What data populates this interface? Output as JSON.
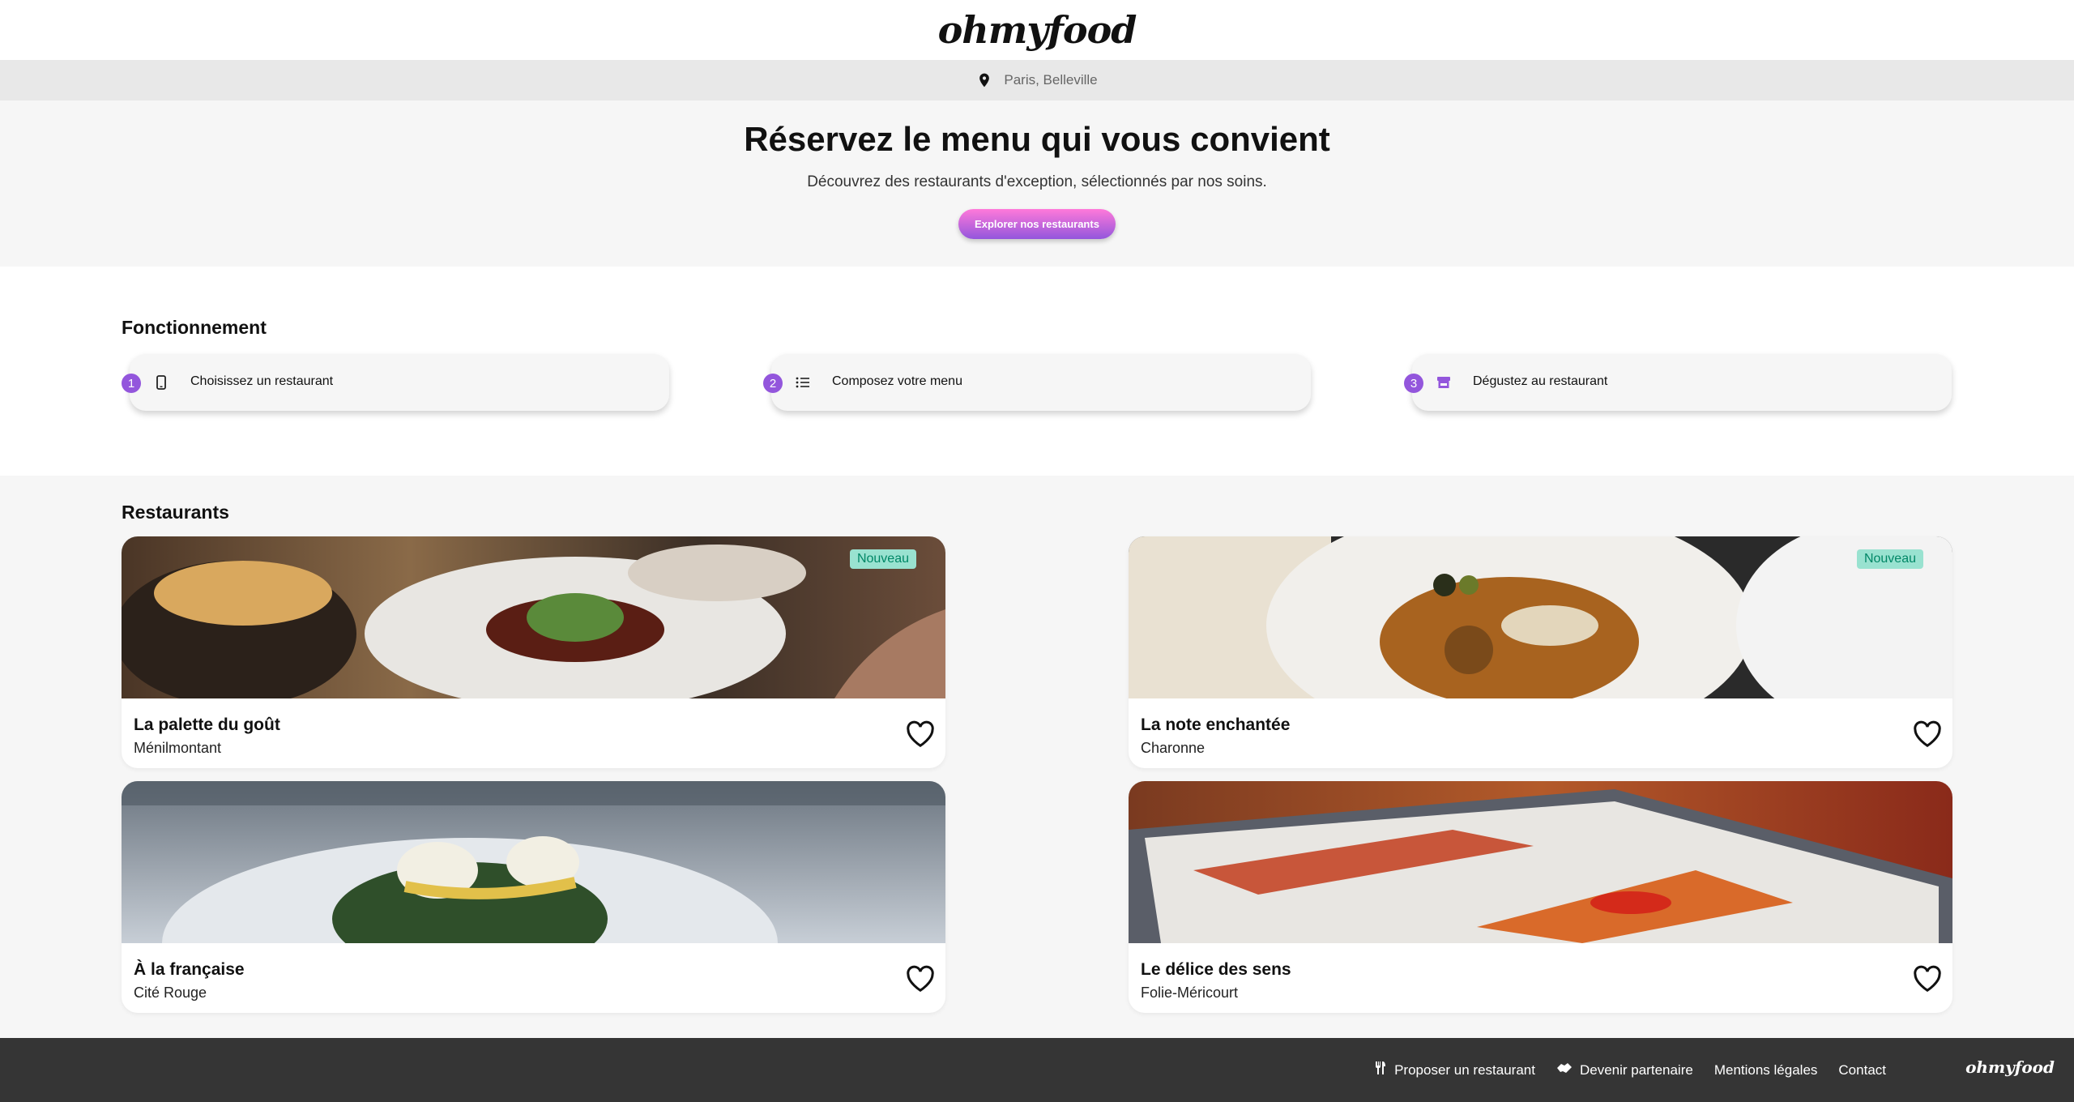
{
  "header": {
    "logo": "ohmyfood"
  },
  "location": {
    "text": "Paris, Belleville",
    "icon": "map-pin-icon"
  },
  "hero": {
    "title": "Réservez le menu qui vous convient",
    "subtitle": "Découvrez des restaurants d'exception, sélectionnés par nos soins.",
    "cta": "Explorer nos restaurants"
  },
  "how": {
    "title": "Fonctionnement",
    "steps": [
      {
        "num": "1",
        "label": "Choisissez un restaurant",
        "icon": "phone-icon"
      },
      {
        "num": "2",
        "label": "Composez votre menu",
        "icon": "list-icon"
      },
      {
        "num": "3",
        "label": "Dégustez au restaurant",
        "icon": "store-icon"
      }
    ]
  },
  "restaurants": {
    "title": "Restaurants",
    "items": [
      {
        "name": "La palette du goût",
        "area": "Ménilmontant",
        "badge": "Nouveau"
      },
      {
        "name": "La note enchantée",
        "area": "Charonne",
        "badge": "Nouveau"
      },
      {
        "name": "À la française",
        "area": "Cité Rouge",
        "badge": ""
      },
      {
        "name": "Le délice des sens",
        "area": "Folie-Méricourt",
        "badge": ""
      }
    ]
  },
  "footer": {
    "links": [
      {
        "label": "Proposer un restaurant",
        "icon": "utensils-icon"
      },
      {
        "label": "Devenir partenaire",
        "icon": "handshake-icon"
      },
      {
        "label": "Mentions légales",
        "icon": ""
      },
      {
        "label": "Contact",
        "icon": ""
      }
    ],
    "logo": "ohmyfood"
  },
  "colors": {
    "accent_purple": "#9356dc",
    "accent_pink": "#ff79da",
    "badge_bg": "#99e2d0",
    "badge_text": "#008766",
    "footer_bg": "#353535"
  }
}
